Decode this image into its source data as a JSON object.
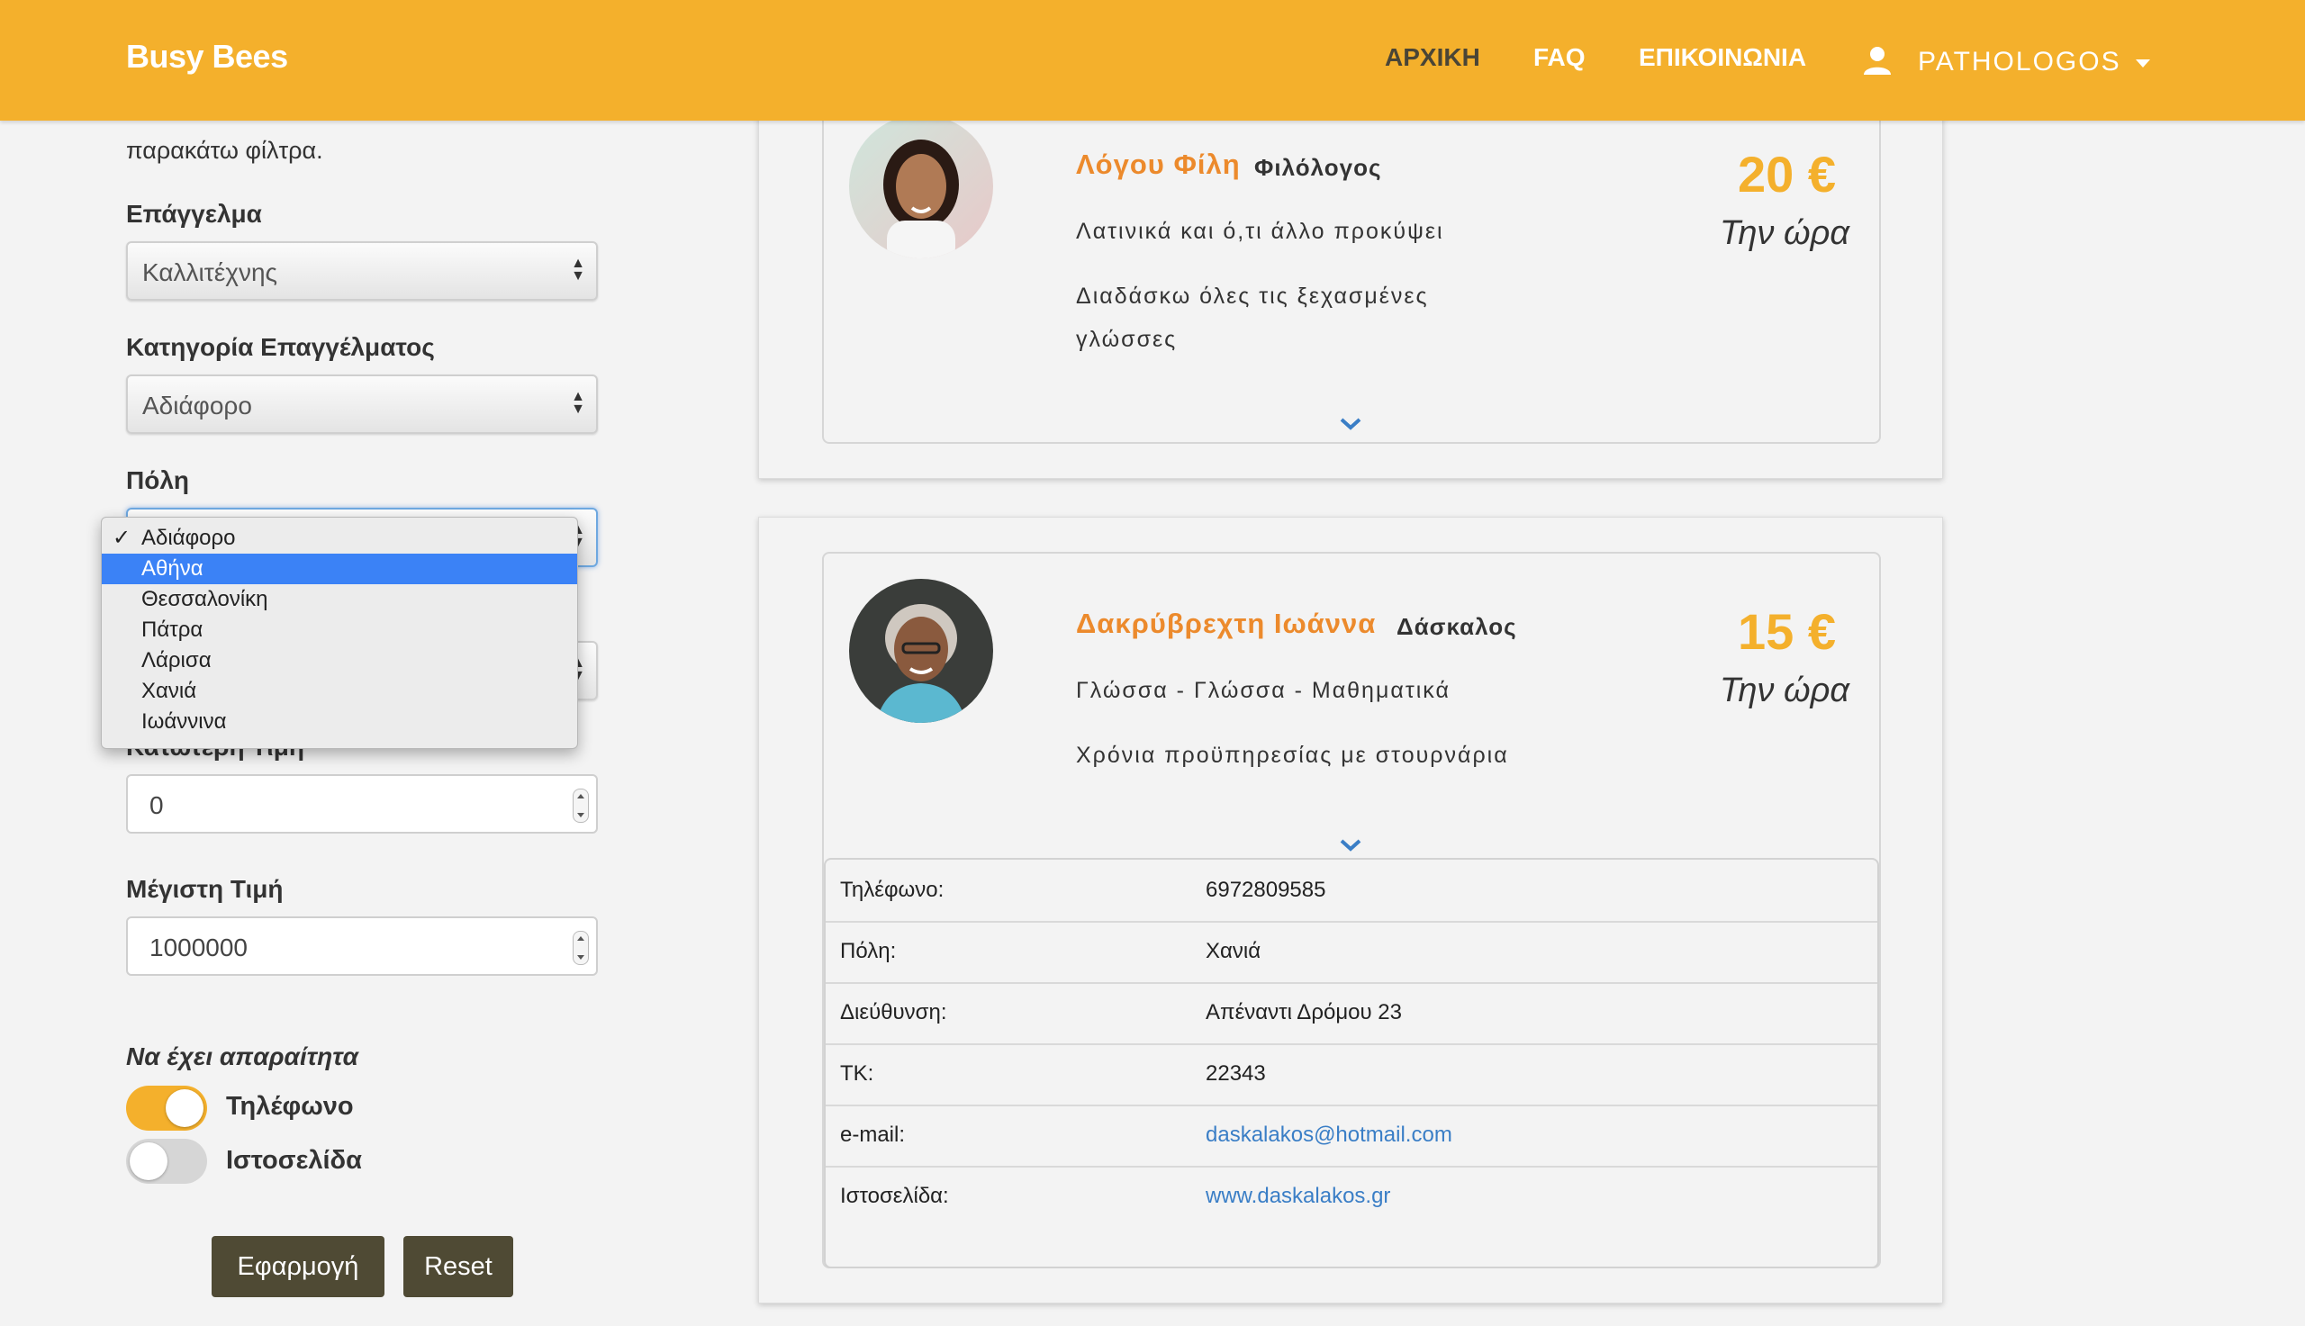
{
  "navbar": {
    "brand": "Busy Bees",
    "links": [
      "ΑΡΧΙΚΗ",
      "FAQ",
      "ΕΠΙΚΟΙΝΩΝΙΑ"
    ],
    "user": "PATHOLOGOS",
    "color": "#f4b02c"
  },
  "sidebar": {
    "intro_cut": "                    ",
    "intro": "παρακάτω φίλτρα.",
    "profession_label": "Επάγγελμα",
    "profession_value": "Καλλιτέχνης",
    "category_label": "Κατηγορία Επαγγέλματος",
    "category_value": "Αδιάφορο",
    "city_label": "Πόλη",
    "city_options": [
      "Αδιάφορο",
      "Αθήνα",
      "Θεσσαλονίκη",
      "Πάτρα",
      "Λάρισα",
      "Χανιά",
      "Ιωάννινα"
    ],
    "city_selected": "Αδιάφορο",
    "city_highlighted": "Αθήνα",
    "min_price_label": "Κατώτερη Τιμή",
    "min_price_value": "0",
    "max_price_label": "Μέγιστη Τιμή",
    "max_price_value": "1000000",
    "required_title": "Να έχει απαραίτητα",
    "toggle_phone_label": "Τηλέφωνο",
    "toggle_phone_on": true,
    "toggle_website_label": "Ιστοσελίδα",
    "toggle_website_on": false,
    "apply_label": "Εφαρμογή",
    "reset_label": "Reset"
  },
  "teachers": [
    {
      "name": "Λόγου Φίλη",
      "profession": "Φιλόλογος",
      "subjects": "Λατινικά και ό,τι άλλο προκύψει",
      "description_line1": "Διαδάσκω όλες τις ξεχασμένες",
      "description_line2": "γλώσσες",
      "price": "20 €",
      "per": "Την ώρα"
    },
    {
      "name": "Δακρύβρεχτη Ιωάννα",
      "profession": "Δάσκαλος",
      "subjects": "Γλώσσα - Γλώσσα - Μαθηματικά",
      "description_line1": "Χρόνια προϋπηρεσίας με στουρνάρια",
      "price": "15 €",
      "per": "Την ώρα",
      "details": [
        {
          "key": "Τηλέφωνο:",
          "value": "6972809585"
        },
        {
          "key": "Πόλη:",
          "value": "Χανιά"
        },
        {
          "key": "Διεύθυνση:",
          "value": "Απέναντι Δρόμου 23"
        },
        {
          "key": "ΤΚ:",
          "value": "22343"
        },
        {
          "key": "e-mail:",
          "value": "daskalakos@hotmail.com"
        },
        {
          "key": "Ιστοσελίδα:",
          "value": "www.daskalakos.gr"
        }
      ]
    }
  ]
}
